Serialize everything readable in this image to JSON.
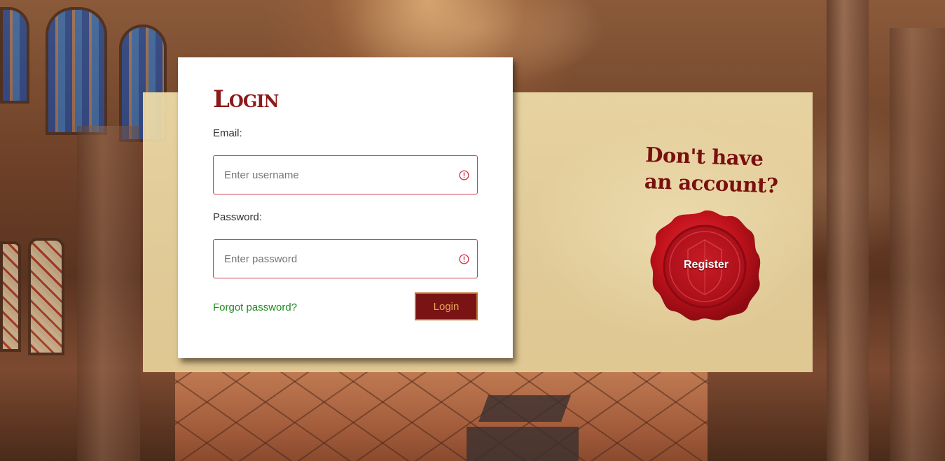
{
  "login": {
    "title": "Login",
    "email_label": "Email:",
    "email_placeholder": "Enter username",
    "password_label": "Password:",
    "password_placeholder": "Enter password",
    "forgot_label": "Forgot password?",
    "submit_label": "Login"
  },
  "register": {
    "prompt": "Don't have an account?",
    "button_label": "Register"
  },
  "colors": {
    "brand_red": "#7a1414",
    "input_error_border": "#cc3d4e",
    "link_green": "#1e8a1e",
    "button_text": "#e8a35a",
    "parchment": "#ecd9a0"
  },
  "icons": {
    "input_status": "exclamation-circle-icon",
    "register": "wax-seal-icon"
  }
}
